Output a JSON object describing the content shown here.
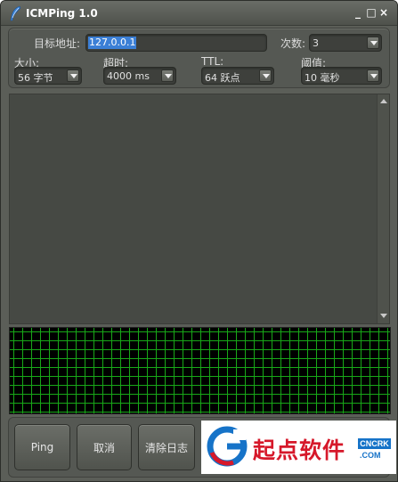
{
  "window": {
    "title": "ICMPing 1.0",
    "minimize": "_",
    "maximize": "□",
    "close": "×"
  },
  "form": {
    "target_label": "目标地址:",
    "target_value": "127.0.0.1",
    "count_label": "次数:",
    "count_value": "3",
    "size_label": "大小:",
    "size_value": "56 字节",
    "timeout_label": "超时:",
    "timeout_value": "4000 ms",
    "ttl_label": "TTL:",
    "ttl_value": "64 跃点",
    "threshold_label": "阈值:",
    "threshold_value": "10 毫秒"
  },
  "buttons": {
    "ping": "Ping",
    "cancel": "取消",
    "clear_log": "清除日志"
  },
  "watermark": {
    "text": "起点软件",
    "badge": "CNCRK",
    "domain": ".COM"
  },
  "colors": {
    "window_bg": "#5b5e58",
    "graph_bg": "#000000",
    "graph_grid": "#18a818",
    "selection": "#3b7fd6",
    "brand_red": "#d6182a",
    "brand_blue": "#1673c8"
  },
  "icons": {
    "app": "feather-icon",
    "watermark_logo": "g-swirl-logo-icon"
  }
}
